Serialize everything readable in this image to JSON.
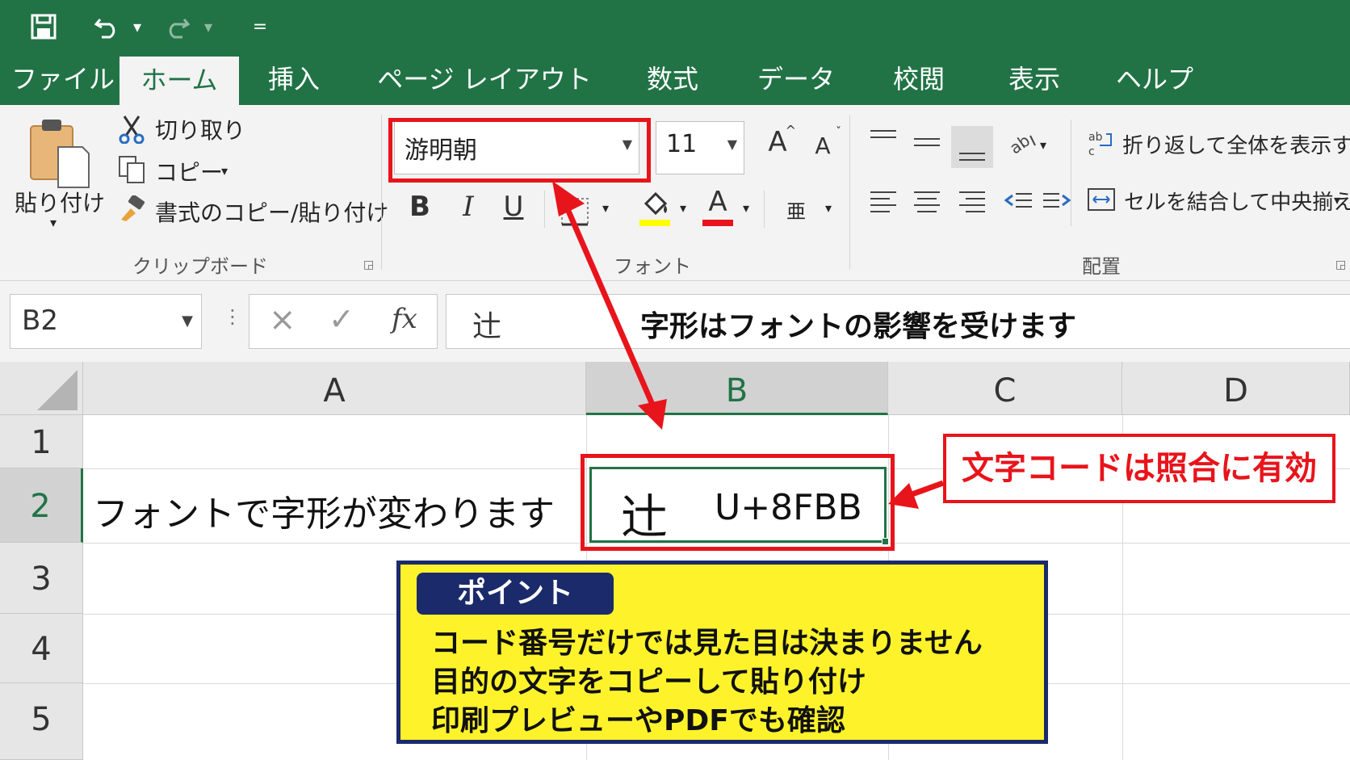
{
  "quick_access": {
    "undo_arrow": "▾",
    "redo_arrow": "▾",
    "customize": "="
  },
  "tabs": [
    "ファイル",
    "ホーム",
    "挿入",
    "ページ レイアウト",
    "数式",
    "データ",
    "校閲",
    "表示",
    "ヘルプ"
  ],
  "active_tab": "ホーム",
  "ribbon": {
    "clipboard": {
      "paste_label": "貼り付け",
      "cut_label": "切り取り",
      "copy_label": "コピー",
      "format_painter_label": "書式のコピー/貼り付け",
      "group_label": "クリップボード"
    },
    "font": {
      "font_name": "游明朝",
      "font_size": "11",
      "grow_label": "A",
      "shrink_label": "A",
      "bold": "B",
      "italic": "I",
      "underline": "U",
      "font_color_label": "A",
      "phonetic_label": "亜",
      "group_label": "フォント",
      "fill_color": "#ffff00",
      "text_color": "#e8141b"
    },
    "alignment": {
      "wrap_text_label": "折り返して全体を表示する",
      "merge_center_label": "セルを結合して中央揃え",
      "group_label": "配置"
    }
  },
  "formula_bar": {
    "name_box": "B2",
    "cancel": "×",
    "enter": "✓",
    "fx": "fx",
    "content": "辻"
  },
  "annotation_title": "字形はフォントの影響を受けます",
  "columns": [
    "A",
    "B",
    "C",
    "D"
  ],
  "rows": [
    "1",
    "2",
    "3",
    "4",
    "5"
  ],
  "cells": {
    "A2": "フォントで字形が変わります",
    "B2_char": "辻",
    "B2_code": "U+8FBB"
  },
  "code_note": "文字コードは照合に有効",
  "point_box": {
    "tag": "ポイント",
    "lines": [
      "コード番号だけでは見た目は決まりません",
      "目的の文字をコピーして貼り付け",
      "印刷プレビューやPDFでも確認"
    ]
  },
  "colors": {
    "excel_green": "#217346",
    "callout_red": "#e8141b",
    "note_yellow": "#fef32b",
    "note_navy": "#1b2a6b"
  }
}
